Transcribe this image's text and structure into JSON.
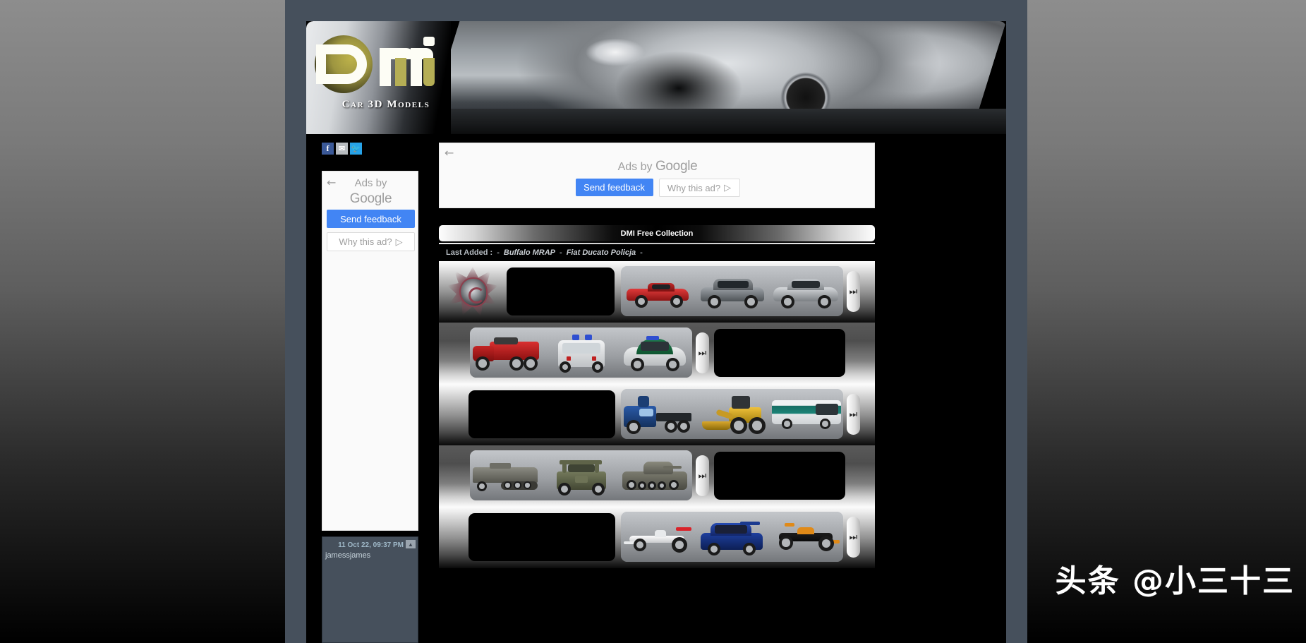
{
  "site": {
    "logo_text": "DMI",
    "tagline": "Car 3D Models"
  },
  "social": [
    {
      "name": "facebook",
      "glyph": "f"
    },
    {
      "name": "email",
      "glyph": "✉"
    },
    {
      "name": "twitter",
      "glyph": "🐦"
    }
  ],
  "sidebar_ad": {
    "back_arrow": "←",
    "ads_by": "Ads by",
    "google": "Google",
    "send_feedback": "Send feedback",
    "why_this_ad": "Why this ad?",
    "why_icon": "▷"
  },
  "top_ad": {
    "back_arrow": "←",
    "ads_by": "Ads by ",
    "google": "Google",
    "send_feedback": "Send feedback",
    "why_this_ad": "Why this ad?",
    "why_icon": "▷"
  },
  "collection": {
    "title": "DMI Free Collection",
    "last_added_label": "Last Added :",
    "dash": "-",
    "last_added_items": [
      "Buffalo MRAP",
      "Fiat Ducato Policja"
    ]
  },
  "rows": [
    {
      "id": "row-cars",
      "tone": "light",
      "layout": "logo-black-thumbs",
      "skip_glyph": "⏭",
      "thumbs": [
        "red-roadster",
        "grey-sedan",
        "silver-coupe"
      ]
    },
    {
      "id": "row-emergency",
      "tone": "dark",
      "layout": "thumbs-black",
      "skip_glyph": "⏭",
      "thumbs": [
        "red-fire-truck",
        "white-ambulance",
        "polizei-beetle"
      ]
    },
    {
      "id": "row-heavy",
      "tone": "light",
      "layout": "black-thumbs",
      "skip_glyph": "⏭",
      "thumbs": [
        "blue-semi-truck",
        "yellow-wheel-loader",
        "city-bus"
      ]
    },
    {
      "id": "row-military",
      "tone": "dark",
      "layout": "thumbs-black",
      "skip_glyph": "⏭",
      "thumbs": [
        "grey-halftrack",
        "army-jeep",
        "panzer-tank"
      ]
    },
    {
      "id": "row-racing",
      "tone": "light",
      "layout": "black-thumbs",
      "skip_glyph": "⏭",
      "thumbs": [
        "white-f1-car",
        "blue-rally-car",
        "orange-open-wheeler"
      ]
    }
  ],
  "shoutbox": {
    "timestamp": "11 Oct 22, 09:37 PM",
    "scroll_up": "▲",
    "message": "jamessjames"
  },
  "watermark": "头条 @小三十三",
  "colors": {
    "page_bg_slate": "#46505c",
    "google_blue": "#4285f4",
    "logo_gold": "#b5ae55",
    "facebook_blue": "#3b5998",
    "twitter_blue": "#27a3e8"
  }
}
